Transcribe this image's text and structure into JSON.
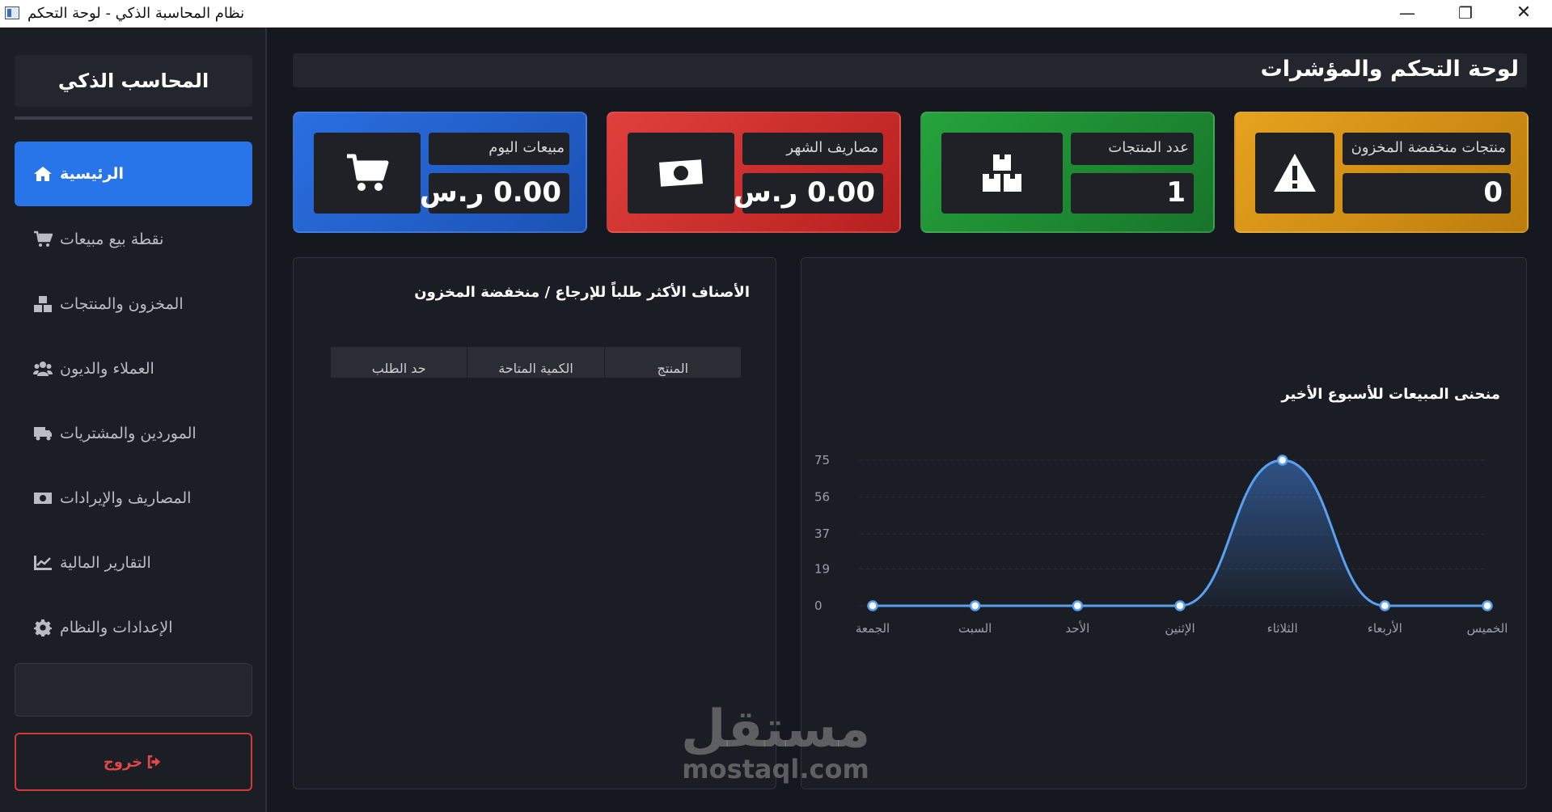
{
  "window": {
    "title": "نظام المحاسبة الذكي - لوحة التحكم",
    "minimize": "—",
    "maximize": "❐",
    "close": "✕"
  },
  "sidebar": {
    "brand": "المحاسب الذكي",
    "items": [
      {
        "label": "الرئيسية",
        "icon": "home-icon",
        "active": true
      },
      {
        "label": "نقطة بيع مبيعات",
        "icon": "cart-icon"
      },
      {
        "label": "المخزون والمنتجات",
        "icon": "boxes-icon"
      },
      {
        "label": "العملاء والديون",
        "icon": "users-icon"
      },
      {
        "label": "الموردين والمشتريات",
        "icon": "truck-icon"
      },
      {
        "label": "المصاريف والإيرادات",
        "icon": "money-icon"
      },
      {
        "label": "التقارير المالية",
        "icon": "chart-line-icon"
      },
      {
        "label": "الإعدادات والنظام",
        "icon": "gear-icon"
      }
    ],
    "logout": "خروج"
  },
  "header": {
    "title": "لوحة التحكم والمؤشرات"
  },
  "cards": [
    {
      "label": "مبيعات اليوم",
      "value": "0.00 ر.س",
      "icon": "cart-icon",
      "color": "#2a6fe0"
    },
    {
      "label": "مصاريف الشهر",
      "value": "0.00 ر.س",
      "icon": "money-icon",
      "color": "#e0403c"
    },
    {
      "label": "عدد المنتجات",
      "value": "1",
      "icon": "boxes-icon",
      "color": "#25a33c"
    },
    {
      "label": "منتجات منخفضة المخزون",
      "value": "0",
      "icon": "warning-icon",
      "color": "#e6a21f"
    }
  ],
  "low_stock": {
    "title": "الأصناف الأكثر طلباً للإرجاع / منخفضة المخزون",
    "columns": [
      "المنتج",
      "الكمية المتاحة",
      "حد الطلب"
    ]
  },
  "sales_chart": {
    "title": "منحنى المبيعات للأسبوع الأخير"
  },
  "chart_data": {
    "type": "line",
    "title": "منحنى المبيعات للأسبوع الأخير",
    "categories": [
      "الخميس",
      "الأربعاء",
      "الثلاثاء",
      "الإثنين",
      "الأحد",
      "السبت",
      "الجمعة"
    ],
    "values": [
      0,
      0,
      75,
      0,
      0,
      0,
      0
    ],
    "yticks": [
      "0",
      "19",
      "37",
      "56",
      "75"
    ],
    "ylim": [
      0,
      75
    ],
    "grid": true,
    "color": "#5aa0f0"
  },
  "watermark": {
    "arabic": "مستقل",
    "latin": "mostaql.com"
  }
}
